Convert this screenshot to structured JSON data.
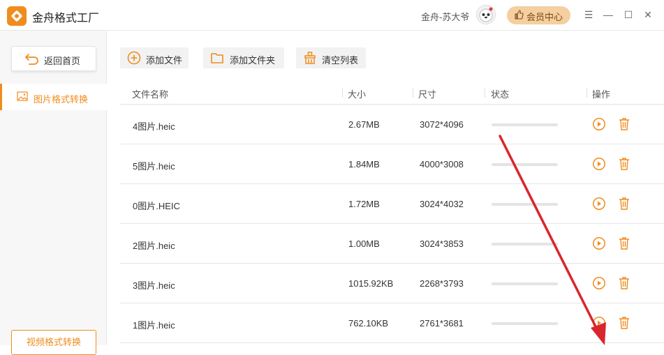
{
  "app": {
    "title": "金舟格式工厂"
  },
  "header": {
    "username": "金舟-苏大爷",
    "vip_label": "会员中心",
    "menu_glyph": "☰",
    "minimize_glyph": "—",
    "maximize_glyph": "☐",
    "close_glyph": "✕"
  },
  "sidebar": {
    "back_label": "返回首页",
    "nav_label": "图片格式转换",
    "video_label": "视频格式转换"
  },
  "toolbar": {
    "add_file": "添加文件",
    "add_folder": "添加文件夹",
    "clear_list": "清空列表"
  },
  "table": {
    "headers": {
      "name": "文件名称",
      "size": "大小",
      "dim": "尺寸",
      "status": "状态",
      "action": "操作"
    },
    "rows": [
      {
        "name": "4图片.heic",
        "size": "2.67MB",
        "dim": "3072*4096"
      },
      {
        "name": "5图片.heic",
        "size": "1.84MB",
        "dim": "4000*3008"
      },
      {
        "name": "0图片.HEIC",
        "size": "1.72MB",
        "dim": "3024*4032"
      },
      {
        "name": "2图片.heic",
        "size": "1.00MB",
        "dim": "3024*3853"
      },
      {
        "name": "3图片.heic",
        "size": "1015.92KB",
        "dim": "2268*3793"
      },
      {
        "name": "1图片.heic",
        "size": "762.10KB",
        "dim": "2761*3681"
      }
    ]
  },
  "colors": {
    "accent": "#f08c1e",
    "annotation_arrow": "#d9262c"
  }
}
